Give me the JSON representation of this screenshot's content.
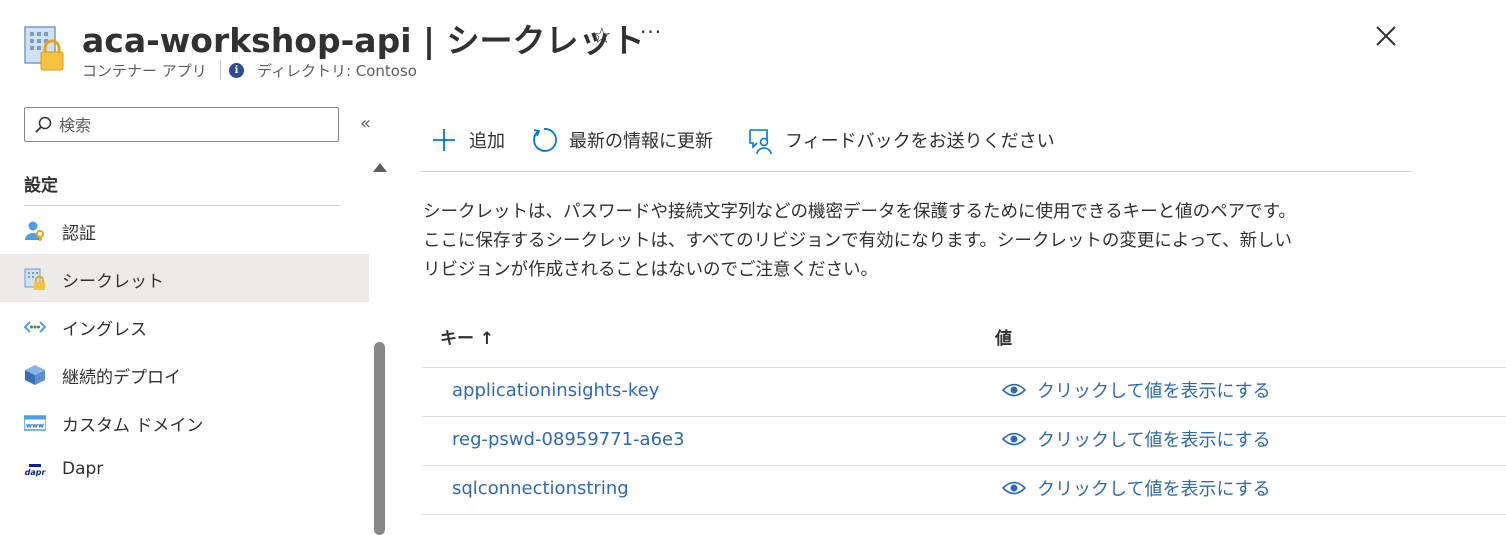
{
  "header": {
    "title": "aca-workshop-api | シークレット",
    "subtitle": "コンテナー アプリ",
    "directory": "ディレクトリ: Contoso",
    "star_icon": "☆",
    "more_icon": "···"
  },
  "sidebar": {
    "search_placeholder": "検索",
    "collapse_icon": "«",
    "section_title": "設定",
    "items": [
      {
        "label": "認証",
        "icon": "auth-icon",
        "selected": false
      },
      {
        "label": "シークレット",
        "icon": "secrets-icon",
        "selected": true
      },
      {
        "label": "イングレス",
        "icon": "ingress-icon",
        "selected": false
      },
      {
        "label": "継続的デプロイ",
        "icon": "deploy-icon",
        "selected": false
      },
      {
        "label": "カスタム ドメイン",
        "icon": "domain-icon",
        "selected": false
      },
      {
        "label": "Dapr",
        "icon": "dapr-icon",
        "selected": false
      }
    ]
  },
  "toolbar": {
    "add_label": "追加",
    "refresh_label": "最新の情報に更新",
    "feedback_label": "フィードバックをお送りください"
  },
  "description": {
    "line1": "シークレットは、パスワードや接続文字列などの機密データを保護するために使用できるキーと値のペアです。",
    "line2": "ここに保存するシークレットは、すべてのリビジョンで有効になります。シークレットの変更によって、新しい",
    "line3": "リビジョンが作成されることはないのでご注意ください。"
  },
  "table": {
    "columns": {
      "key": "キー ↑",
      "value": "値"
    },
    "rows": [
      {
        "key": "applicationinsights-key",
        "value": "クリックして値を表示にする"
      },
      {
        "key": "reg-pswd-08959771-a6e3",
        "value": "クリックして値を表示にする"
      },
      {
        "key": "sqlconnectionstring",
        "value": "クリックして値を表示にする"
      }
    ]
  },
  "colors": {
    "link": "#2e6ab4",
    "selected_bg": "#edebe9",
    "accent": "#0078d4"
  }
}
